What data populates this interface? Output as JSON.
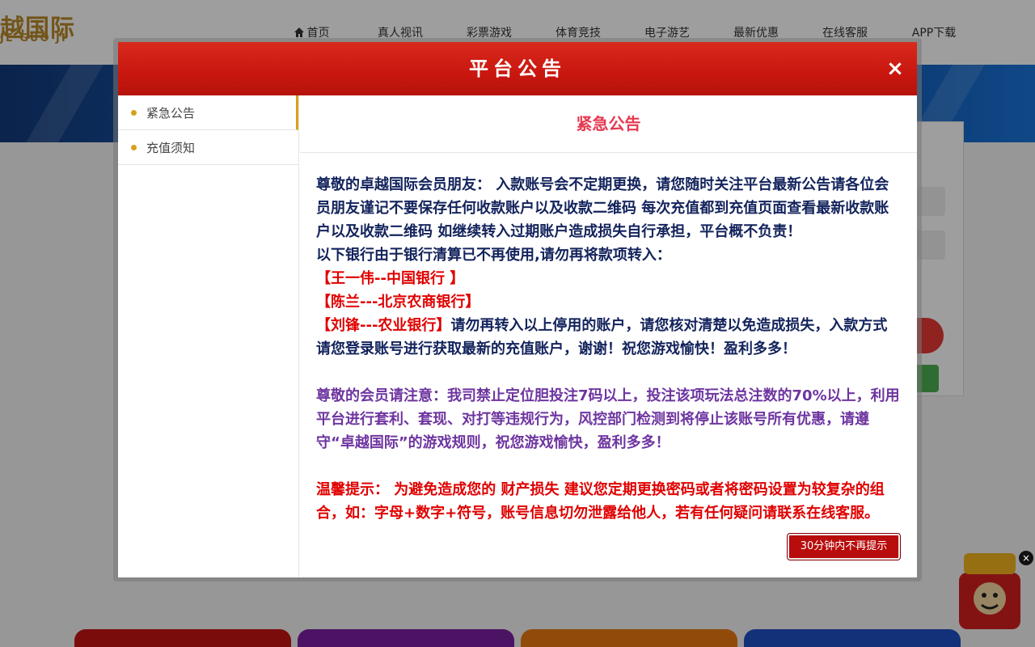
{
  "site": {
    "logo_cn": "越国际",
    "logo_en": "JE GUO JI",
    "nav": [
      "首页",
      "真人视讯",
      "彩票游戏",
      "体育竞技",
      "电子游艺",
      "最新优惠",
      "在线客服",
      "APP下载"
    ]
  },
  "modal": {
    "title": "平台公告",
    "close_glyph": "×",
    "tabs": [
      "紧急公告",
      "充值须知"
    ],
    "active_tab": "紧急公告",
    "content_title": "紧急公告",
    "para1_line1": "尊敬的卓越国际会员朋友： 入款账号会不定期更换，请您随时关注平台最新公告请各位会员朋友谨记不要保存任何收款账户以及收款二维码 每次充值都到充值页面查看最新收款账户以及收款二维码 如继续转入过期账户造成损失自行承担，平台概不负责！",
    "para1_line2": "以下银行由于银行清算已不再使用,请勿再将款项转入：",
    "bank1": "【王一伟--中国银行 】",
    "bank2": "【陈兰---北京农商银行】",
    "bank3": "【刘锋---农业银行】",
    "bank3_note": "请勿再转入以上停用的账户，请您核对清楚以免造成损失，入款方式请您登录账号进行获取最新的充值账户，谢谢！祝您游戏愉快！盈利多多！",
    "para2": "尊敬的会员请注意：我司禁止定位胆投注7码以上，投注该项玩法总注数的70%以上，利用平台进行套利、套现、对打等违规行为，风控部门检测到将停止该账号所有优惠，请遵守“卓越国际”的游戏规则，祝您游戏愉快，盈利多多！",
    "para3": "温馨提示： 为避免造成您的 财产损失 建议您定期更换密码或者将密码设置为较复杂的组合，如：字母+数字+符号，账号信息切勿泄露给他人，若有任何疑问请联系在线客服。",
    "dismiss_label": "30分钟内不再提示"
  },
  "colors": {
    "header_red": "#c9170f",
    "tab_accent": "#d6a21a",
    "content_title": "#e53950",
    "navy_text": "#13235c",
    "red_text": "#e00000",
    "purple_text": "#6e35a0"
  }
}
